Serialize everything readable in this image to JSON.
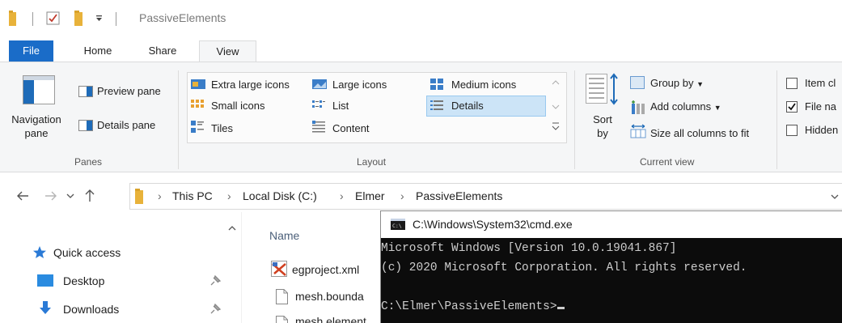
{
  "window": {
    "title": "PassiveElements"
  },
  "tabs": [
    "File",
    "Home",
    "Share",
    "View"
  ],
  "ribbon": {
    "panes": {
      "label": "Panes",
      "navigation_pane": "Navigation pane",
      "preview_pane": "Preview pane",
      "details_pane": "Details pane"
    },
    "layout": {
      "label": "Layout",
      "extra_large_icons": "Extra large icons",
      "large_icons": "Large icons",
      "medium_icons": "Medium icons",
      "small_icons": "Small icons",
      "list": "List",
      "details": "Details",
      "tiles": "Tiles",
      "content": "Content"
    },
    "current_view": {
      "label": "Current view",
      "sort_by": "Sort by",
      "group_by": "Group by",
      "add_columns": "Add columns",
      "size_columns": "Size all columns to fit"
    },
    "show_hide": {
      "item_checkboxes": "Item cl",
      "file_name_ext": "File na",
      "hidden_items": "Hidden"
    }
  },
  "address": {
    "crumbs": [
      "This PC",
      "Local Disk (C:)",
      "Elmer",
      "PassiveElements"
    ]
  },
  "nav": {
    "items": [
      "Quick access",
      "Desktop",
      "Downloads"
    ]
  },
  "files": {
    "column_name": "Name",
    "items": [
      "egproject.xml",
      "mesh.bounda",
      "mesh.element"
    ]
  },
  "cmd": {
    "title": "C:\\Windows\\System32\\cmd.exe",
    "lines": [
      "Microsoft Windows [Version 10.0.19041.867]",
      "(c) 2020 Microsoft Corporation. All rights reserved.",
      "",
      "C:\\Elmer\\PassiveElements>"
    ]
  }
}
